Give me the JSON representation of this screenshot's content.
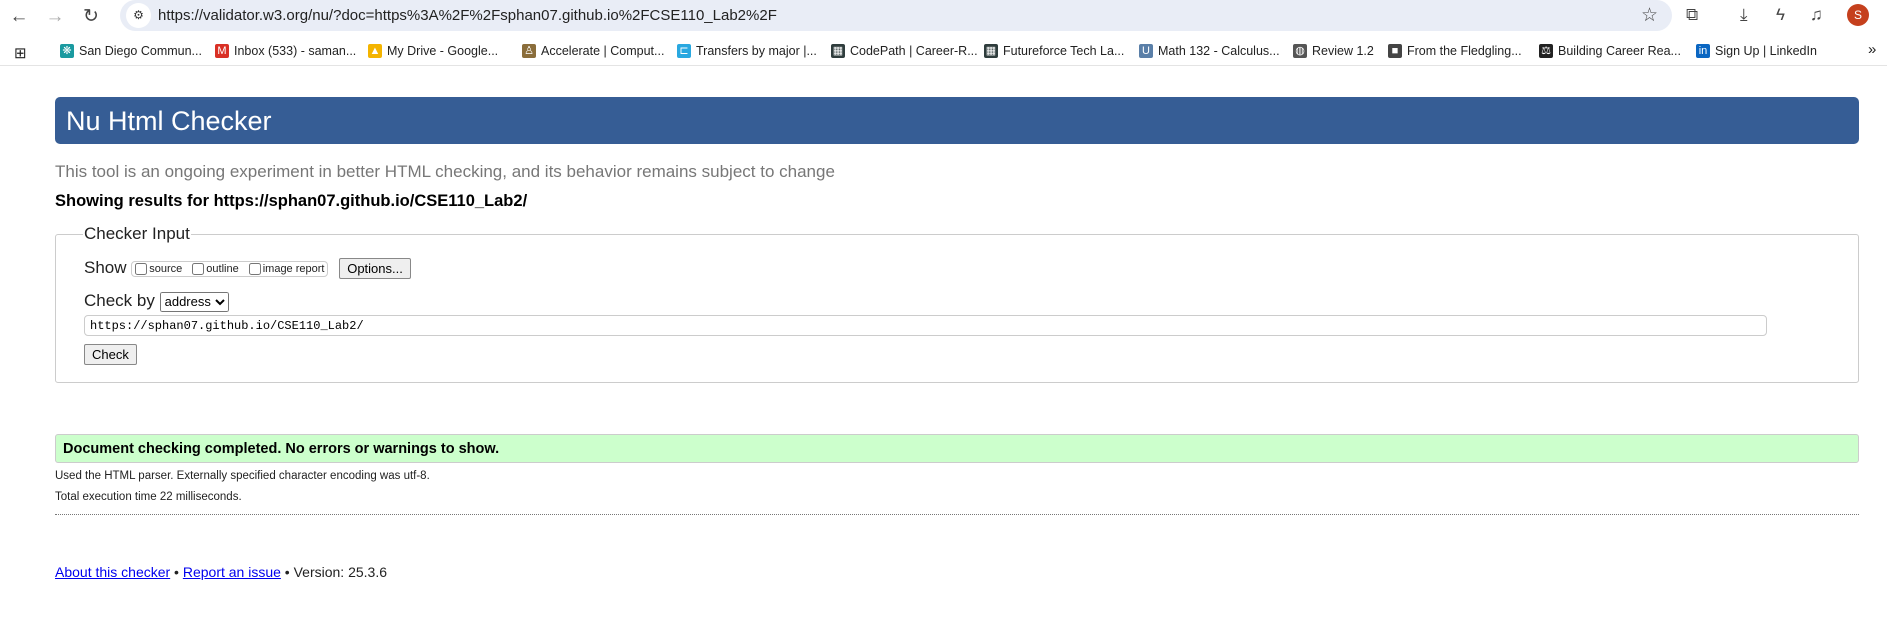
{
  "browser": {
    "url": "https://validator.w3.org/nu/?doc=https%3A%2F%2Fsphan07.github.io%2FCSE110_Lab2%2F",
    "avatar_letter": "S",
    "bookmarks": [
      {
        "label": "San Diego Commun...",
        "icon": "sd-icon",
        "color": "#1a9aa0",
        "glyph": "❋"
      },
      {
        "label": "Inbox (533) - saman...",
        "icon": "gmail-icon",
        "color": "#d93025",
        "glyph": "M"
      },
      {
        "label": "My Drive - Google...",
        "icon": "drive-icon",
        "color": "#f4b400",
        "glyph": "▲"
      },
      {
        "label": "Accelerate | Comput...",
        "icon": "accelerate-icon",
        "color": "#8a6d3b",
        "glyph": "♙"
      },
      {
        "label": "Transfers by major |...",
        "icon": "transfers-icon",
        "color": "#29a8e0",
        "glyph": "⊏"
      },
      {
        "label": "CodePath | Career-R...",
        "icon": "codepath-icon",
        "color": "#2f3d3d",
        "glyph": "▦"
      },
      {
        "label": "Futureforce Tech La...",
        "icon": "futureforce-icon",
        "color": "#2f3d3d",
        "glyph": "▦"
      },
      {
        "label": "Math 132 - Calculus...",
        "icon": "ucla-icon",
        "color": "#5a7fa8",
        "glyph": "U"
      },
      {
        "label": "Review 1.2",
        "icon": "globe-icon",
        "color": "#555",
        "glyph": "◍"
      },
      {
        "label": "From the Fledgling...",
        "icon": "cube-icon",
        "color": "#444",
        "glyph": "■"
      },
      {
        "label": "Building Career Rea...",
        "icon": "career-icon",
        "color": "#222",
        "glyph": "⚖"
      },
      {
        "label": "Sign Up | LinkedIn",
        "icon": "linkedin-icon",
        "color": "#0a66c2",
        "glyph": "in"
      }
    ],
    "overflow": "»"
  },
  "page": {
    "title": "Nu Html Checker",
    "tagline": "This tool is an ongoing experiment in better HTML checking, and its behavior remains subject to change",
    "showing_results": "Showing results for https://sphan07.github.io/CSE110_Lab2/",
    "checker_input": {
      "legend": "Checker Input",
      "show_label": "Show",
      "show_options": [
        "source",
        "outline",
        "image report"
      ],
      "options_button": "Options...",
      "check_by_label": "Check by",
      "check_by_value": "address",
      "url_value": "https://sphan07.github.io/CSE110_Lab2/",
      "check_button": "Check"
    },
    "result_message": "Document checking completed. No errors or warnings to show.",
    "parser_info": "Used the HTML parser. Externally specified character encoding was utf-8.",
    "execution_time": "Total execution time 22 milliseconds.",
    "footer": {
      "about_link": "About this checker",
      "report_link": "Report an issue",
      "version": "Version: 25.3.6"
    }
  }
}
